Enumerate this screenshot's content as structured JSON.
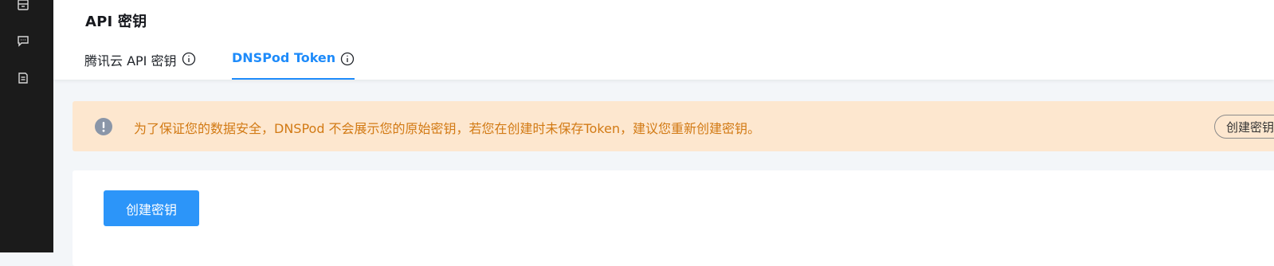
{
  "sidebar": {
    "icons": [
      "archive-icon",
      "message-icon",
      "document-icon"
    ]
  },
  "header": {
    "title": "API 密钥",
    "tabs": [
      {
        "label": "腾讯云 API 密钥",
        "active": false
      },
      {
        "label": "DNSPod Token",
        "active": true
      }
    ]
  },
  "alert": {
    "message": "为了保证您的数据安全，DNSPod 不会展示您的原始密钥，若您在创建时未保存Token，建议您重新创建密钥。",
    "button_label": "创建密钥"
  },
  "main": {
    "create_button_label": "创建密钥"
  },
  "colors": {
    "accent": "#1e8bfa",
    "primary_button": "#2c95f9",
    "alert_background": "#fde7cf",
    "alert_text": "#d27a14",
    "sidebar": "#1b1b1b"
  }
}
